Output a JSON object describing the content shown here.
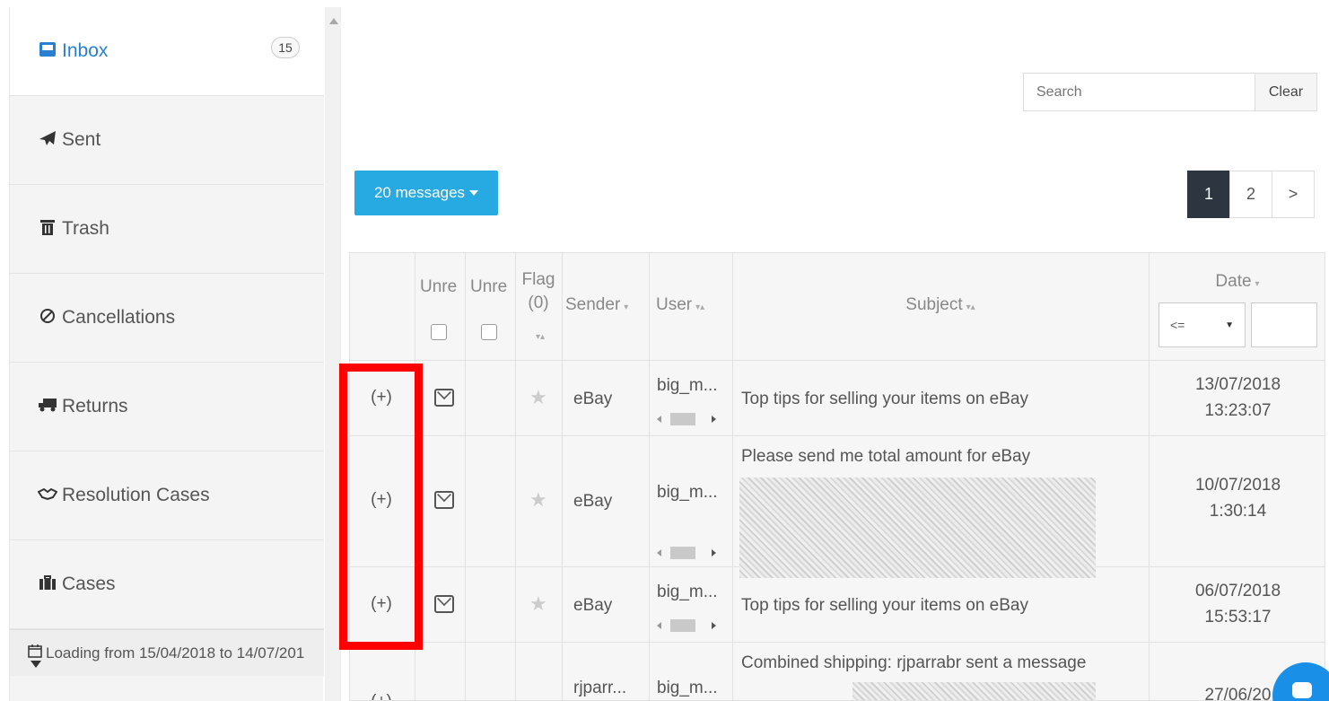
{
  "sidebar": {
    "items": [
      {
        "label": "Inbox",
        "icon": "inbox-icon",
        "badge": "15",
        "active": true
      },
      {
        "label": "Sent",
        "icon": "paper-plane-icon"
      },
      {
        "label": "Trash",
        "icon": "trash-icon"
      },
      {
        "label": "Cancellations",
        "icon": "ban-icon"
      },
      {
        "label": "Returns",
        "icon": "truck-icon"
      },
      {
        "label": "Resolution Cases",
        "icon": "handshake-icon"
      },
      {
        "label": "Cases",
        "icon": "briefcase-icon"
      }
    ],
    "loading_text": "Loading from 15/04/2018 to 14/07/201"
  },
  "search": {
    "placeholder": "Search",
    "clear_label": "Clear"
  },
  "messages_dropdown": {
    "label": "20 messages"
  },
  "pagination": {
    "pages": [
      "1",
      "2"
    ],
    "next": ">",
    "current": "1"
  },
  "table": {
    "headers": {
      "unread1": "Unre",
      "unread2": "Unre",
      "flag": "Flag",
      "flag_count": "(0)",
      "sender": "Sender",
      "user": "User",
      "subject": "Subject",
      "date": "Date",
      "date_operator": "<="
    },
    "rows": [
      {
        "expand": "(+)",
        "sender": "eBay",
        "user": "big_m...",
        "subject": "Top tips for selling your items on eBay",
        "date": "13/07/2018",
        "time": "13:23:07"
      },
      {
        "expand": "(+)",
        "sender": "eBay",
        "user": "big_m...",
        "subject": "Please send me total amount for eBay",
        "date": "10/07/2018",
        "time": "1:30:14"
      },
      {
        "expand": "(+)",
        "sender": "eBay",
        "user": "big_m...",
        "subject": "Top tips for selling your items on eBay",
        "date": "06/07/2018",
        "time": "15:53:17"
      },
      {
        "expand": "(+)",
        "sender": "rjparr...",
        "user": "big_m...",
        "subject": "Combined shipping: rjparrabr sent a message",
        "date": "27/06/20",
        "time": ""
      }
    ]
  },
  "colors": {
    "accent": "#27a9e1",
    "highlight": "#ff0000",
    "pager_active": "#2d3540",
    "link": "#2a7fd0"
  }
}
